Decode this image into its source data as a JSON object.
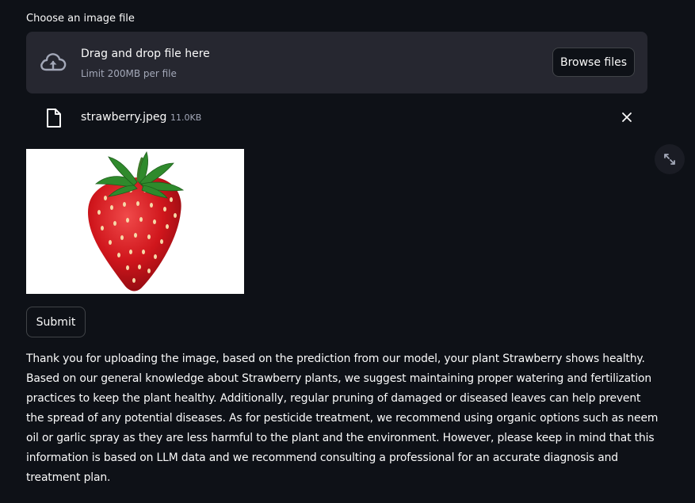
{
  "uploader": {
    "label": "Choose an image file",
    "drop_title": "Drag and drop file here",
    "limit_text": "Limit 200MB per file",
    "browse_label": "Browse files",
    "icons": {
      "upload": "cloud-upload-icon",
      "file": "file-icon",
      "remove": "close-icon",
      "fullscreen": "expand-icon"
    }
  },
  "file": {
    "name": "strawberry.jpeg",
    "size": "11.0KB"
  },
  "preview": {
    "subject": "strawberry",
    "background": "#ffffff"
  },
  "submit_label": "Submit",
  "response_text": "Thank you for uploading the image, based on the prediction from our model, your plant Strawberry shows healthy. Based on our general knowledge about Strawberry plants, we suggest maintaining proper watering and fertilization practices to keep the plant healthy. Additionally, regular pruning of damaged or diseased leaves can help prevent the spread of any potential diseases. As for pesticide treatment, we recommend using organic options such as neem oil or garlic spray as they are less harmful to the plant and the environment. However, please keep in mind that this information is based on LLM data and we recommend consulting a professional for an accurate diagnosis and treatment plan.",
  "colors": {
    "background": "#0e1117",
    "panel": "#262730",
    "text": "#fafafa",
    "muted": "#a3a8b8"
  }
}
